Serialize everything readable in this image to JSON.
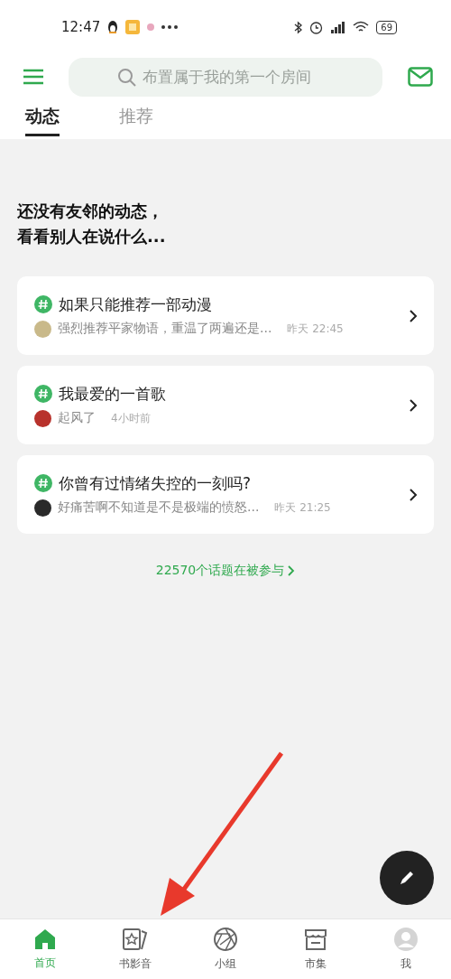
{
  "status_bar": {
    "time": "12:47",
    "battery": "69"
  },
  "header": {
    "search": {
      "placeholder": "布置属于我的第一个房间"
    }
  },
  "tabs": [
    {
      "label": "动态",
      "selected": true
    },
    {
      "label": "推荐",
      "selected": false
    }
  ],
  "empty_message": [
    "还没有友邻的动态，",
    "看看别人在说什么..."
  ],
  "topics": [
    {
      "title": "如果只能推荐一部动漫",
      "excerpt": "强烈推荐平家物语，重温了两遍还是...",
      "time": "昨天 22:45",
      "color": "#c9b98a"
    },
    {
      "title": "我最爱的一首歌",
      "excerpt": "起风了",
      "time": "4小时前",
      "color": "#b8322c"
    },
    {
      "title": "你曾有过情绪失控的一刻吗?",
      "excerpt": "好痛苦啊不知道是不是极端的愤怒...",
      "time": "昨天 21:25",
      "color": "#2a2a2a"
    }
  ],
  "more_link": "22570个话题在被参与",
  "bottom_nav": [
    {
      "label": "首页",
      "kind": "home",
      "selected": true
    },
    {
      "label": "书影音",
      "kind": "media",
      "selected": false
    },
    {
      "label": "小组",
      "kind": "group",
      "selected": false
    },
    {
      "label": "市集",
      "kind": "market",
      "selected": false
    },
    {
      "label": "我",
      "kind": "me",
      "selected": false
    }
  ]
}
